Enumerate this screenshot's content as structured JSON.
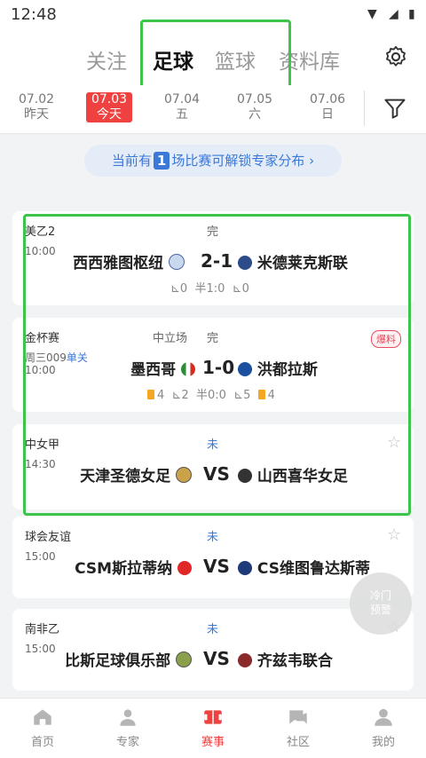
{
  "status_bar": {
    "time": "12:48"
  },
  "top_tabs": [
    {
      "label": "关注",
      "active": false
    },
    {
      "label": "足球",
      "active": true
    },
    {
      "label": "篮球",
      "active": false
    },
    {
      "label": "资料库",
      "active": false
    }
  ],
  "dates": [
    {
      "date": "07.02",
      "label": "昨天",
      "active": false
    },
    {
      "date": "07.03",
      "label": "今天",
      "active": true
    },
    {
      "date": "07.04",
      "label": "五",
      "active": false
    },
    {
      "date": "07.05",
      "label": "六",
      "active": false
    },
    {
      "date": "07.06",
      "label": "日",
      "active": false
    }
  ],
  "notice": {
    "prefix": "当前有",
    "count": "1",
    "suffix": "场比赛可解锁专家分布"
  },
  "matches": [
    {
      "league": "美乙2",
      "time": "10:00",
      "status": "完",
      "home": "西西雅图枢纽",
      "score": "2-1",
      "away": "米德莱克斯联",
      "stats": {
        "home_corner": "0",
        "half": "半1:0",
        "away_corner": "0"
      }
    },
    {
      "league": "金杯赛",
      "neutral": "中立场",
      "time": "10:00",
      "tag": "周三009",
      "tag2": "单关",
      "status": "完",
      "home": "墨西哥",
      "score": "1-0",
      "away": "洪都拉斯",
      "badge": "爆料",
      "stats": {
        "home_yellow": "4",
        "home_corner": "2",
        "half": "半0:0",
        "away_corner": "5",
        "away_yellow": "4"
      }
    },
    {
      "league": "中女甲",
      "time": "14:30",
      "status": "未",
      "home": "天津圣德女足",
      "score": "VS",
      "away": "山西喜华女足"
    },
    {
      "league": "球会友谊",
      "time": "15:00",
      "status": "未",
      "home": "CSM斯拉蒂纳",
      "score": "VS",
      "away": "CS维图鲁达斯蒂"
    },
    {
      "league": "南非乙",
      "time": "15:00",
      "status": "未",
      "home": "比斯足球俱乐部",
      "score": "VS",
      "away": "齐兹韦联合"
    }
  ],
  "float_button": {
    "line1": "冷门",
    "line2": "预警"
  },
  "bottom_nav": [
    {
      "label": "首页",
      "active": false
    },
    {
      "label": "专家",
      "active": false
    },
    {
      "label": "赛事",
      "active": true
    },
    {
      "label": "社区",
      "active": false
    },
    {
      "label": "我的",
      "active": false
    }
  ],
  "colors": {
    "accent": "#f04141",
    "blue": "#3b78d8",
    "highlight": "#3cc54a"
  }
}
